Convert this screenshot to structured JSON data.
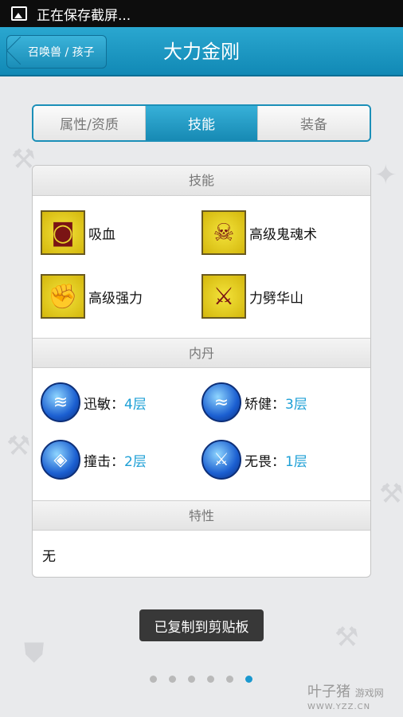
{
  "status_bar": {
    "text": "正在保存截屏..."
  },
  "header": {
    "back_label": "召唤兽 / 孩子",
    "title": "大力金刚"
  },
  "tabs": [
    {
      "label": "属性/资质",
      "active": false
    },
    {
      "label": "技能",
      "active": true
    },
    {
      "label": "装备",
      "active": false
    }
  ],
  "sections": {
    "skills": {
      "title": "技能",
      "items": [
        {
          "name": "吸血",
          "icon": "blood-suck-icon"
        },
        {
          "name": "高级鬼魂术",
          "icon": "skeleton-icon"
        },
        {
          "name": "高级强力",
          "icon": "strength-icon"
        },
        {
          "name": "力劈华山",
          "icon": "mountain-split-icon"
        }
      ]
    },
    "neidan": {
      "title": "内丹",
      "items": [
        {
          "name": "迅敏：",
          "level": "4层",
          "icon": "claw-orb-icon"
        },
        {
          "name": "矫健：",
          "level": "3层",
          "icon": "water-orb-icon"
        },
        {
          "name": "撞击：",
          "level": "2层",
          "icon": "target-orb-icon"
        },
        {
          "name": "无畏：",
          "level": "1层",
          "icon": "weapon-orb-icon"
        }
      ]
    },
    "traits": {
      "title": "特性",
      "value": "无"
    }
  },
  "toast": "已复制到剪贴板",
  "pager": {
    "count": 6,
    "active_index": 5
  },
  "watermark": {
    "brand": "叶子猪",
    "sub": "游戏网",
    "url": "WWW.YZZ.CN"
  }
}
